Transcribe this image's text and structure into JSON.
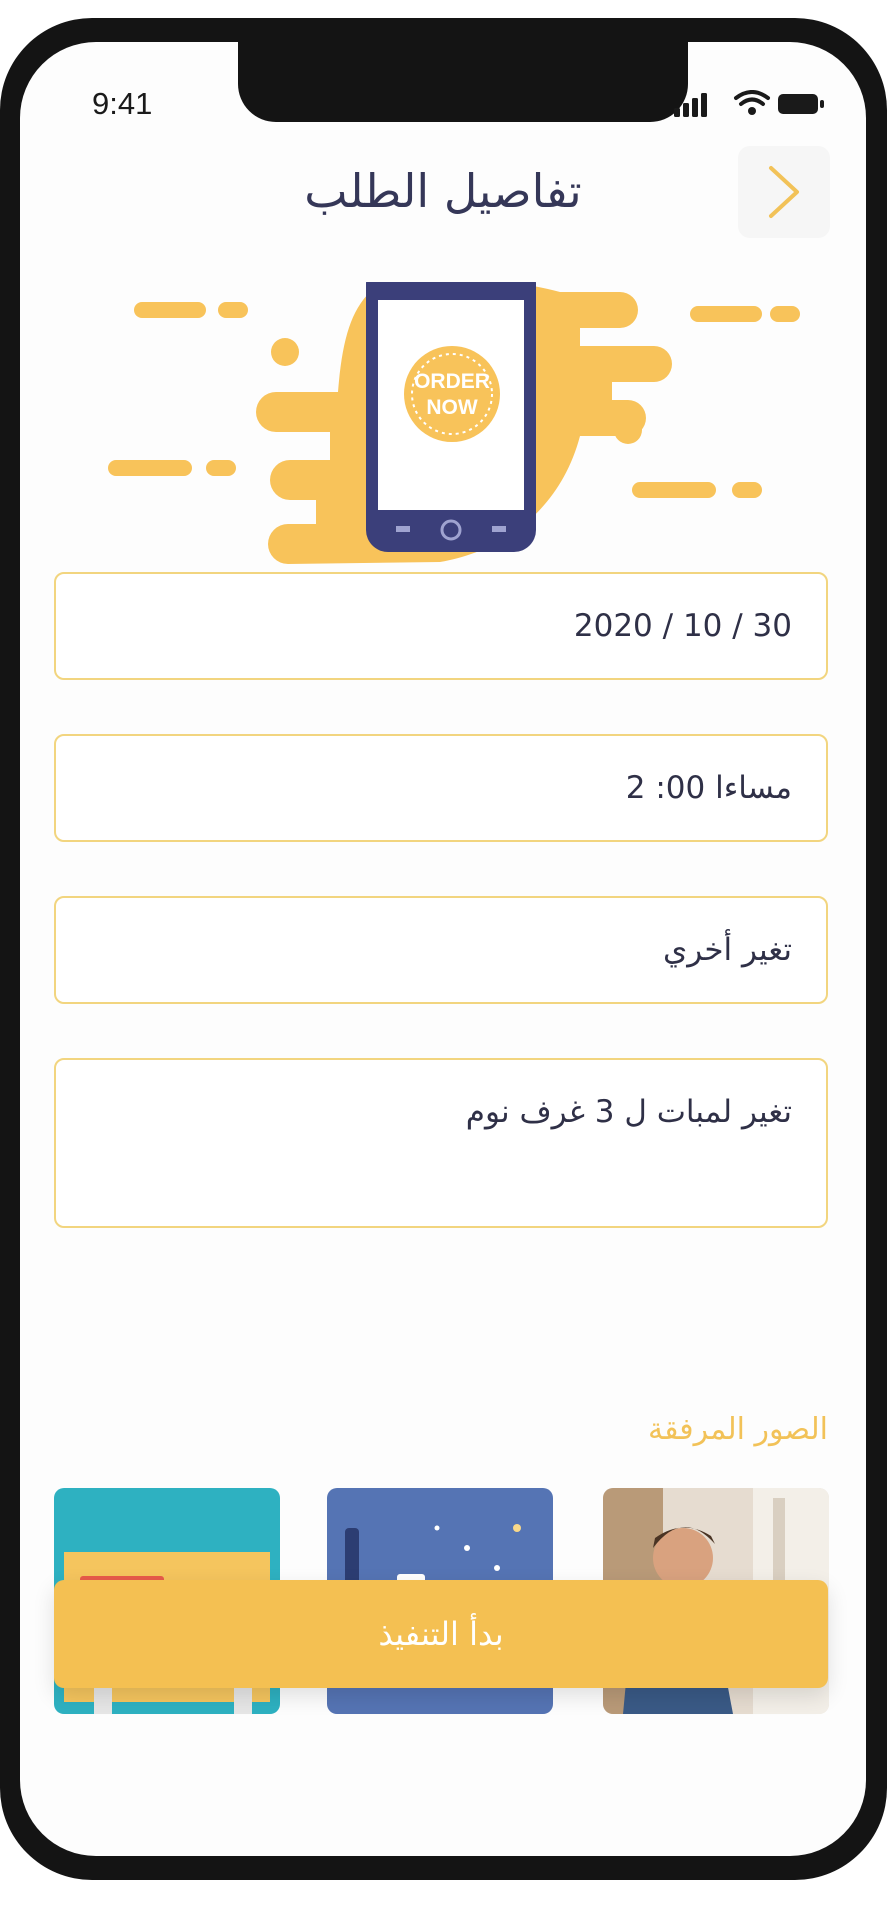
{
  "status_bar": {
    "time": "9:41"
  },
  "header": {
    "title": "تفاصيل الطلب"
  },
  "hero": {
    "badge_line1": "ORDER",
    "badge_line2": "NOW"
  },
  "form": {
    "date_value": "30 / 10 / 2020",
    "time_value": "مساءا 00: 2",
    "service_value": "تغير أخري",
    "notes_value": "تغير لمبات ل 3 غرف نوم"
  },
  "attachments": {
    "label": "الصور المرفقة"
  },
  "actions": {
    "execute_label": "بدأ التنفيذ"
  },
  "colors": {
    "accent": "#f4c052",
    "field_border": "#f2d57f",
    "title": "#353758",
    "phone_illustration": "#3b3f7a"
  }
}
